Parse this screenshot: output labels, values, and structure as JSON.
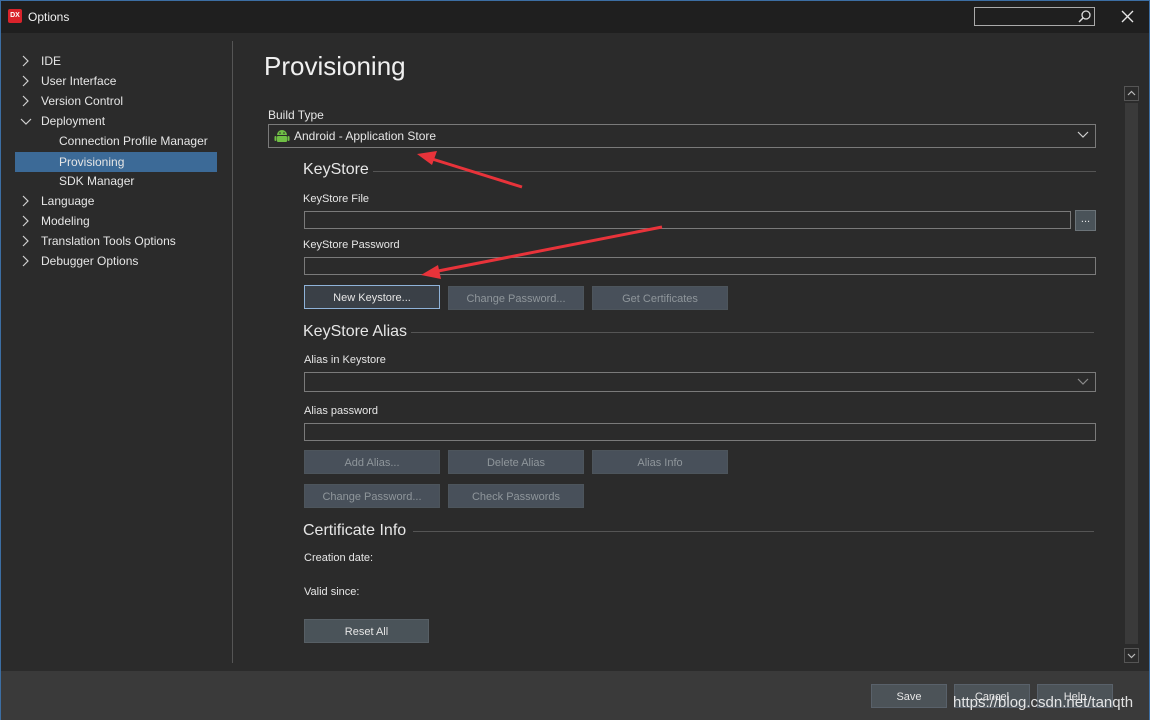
{
  "window": {
    "title": "Options",
    "app_icon_text": "DX",
    "search_placeholder": ""
  },
  "sidebar": {
    "items": [
      {
        "label": "IDE",
        "expanded": false,
        "level": 0
      },
      {
        "label": "User Interface",
        "expanded": false,
        "level": 0
      },
      {
        "label": "Version Control",
        "expanded": false,
        "level": 0
      },
      {
        "label": "Deployment",
        "expanded": true,
        "level": 0
      },
      {
        "label": "Connection Profile Manager",
        "level": 1
      },
      {
        "label": "Provisioning",
        "level": 1,
        "selected": true
      },
      {
        "label": "SDK Manager",
        "level": 1
      },
      {
        "label": "Language",
        "expanded": false,
        "level": 0
      },
      {
        "label": "Modeling",
        "expanded": false,
        "level": 0
      },
      {
        "label": "Translation Tools Options",
        "expanded": false,
        "level": 0
      },
      {
        "label": "Debugger Options",
        "expanded": false,
        "level": 0
      }
    ]
  },
  "main": {
    "heading": "Provisioning",
    "build_type_label": "Build Type",
    "build_type_value": "Android - Application Store",
    "keystore": {
      "section": "KeyStore",
      "file_label": "KeyStore File",
      "file_value": "",
      "browse_label": "...",
      "password_label": "KeyStore Password",
      "password_value": "",
      "new_keystore": "New Keystore...",
      "change_password": "Change Password...",
      "get_certificates": "Get Certificates"
    },
    "alias": {
      "section": "KeyStore Alias",
      "alias_label": "Alias in Keystore",
      "alias_value": "",
      "password_label": "Alias password",
      "password_value": "",
      "add_alias": "Add Alias...",
      "delete_alias": "Delete Alias",
      "alias_info": "Alias Info",
      "change_password": "Change Password...",
      "check_passwords": "Check Passwords"
    },
    "certificate": {
      "section": "Certificate Info",
      "creation_date_label": "Creation date:",
      "valid_since_label": "Valid since:",
      "reset_all": "Reset All"
    }
  },
  "footer": {
    "save": "Save",
    "cancel": "Cancel",
    "help": "Help"
  },
  "watermark": "https://blog.csdn.net/tanqth",
  "colors": {
    "background": "#2b2b2b",
    "selection": "#3c6a97",
    "annotation_arrow": "#e8333a",
    "android_green": "#6fbf45"
  }
}
